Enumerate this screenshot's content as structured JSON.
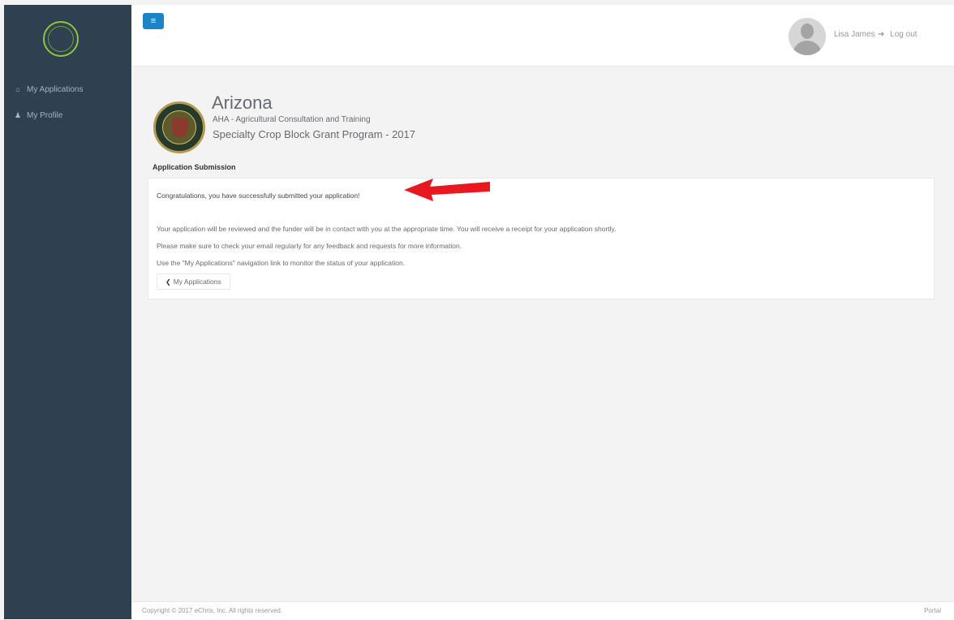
{
  "sidebar": {
    "items": [
      {
        "label": "My Applications",
        "icon": "home-icon",
        "glyph": "⌂"
      },
      {
        "label": "My Profile",
        "icon": "user-icon",
        "glyph": "♟"
      }
    ]
  },
  "topbar": {
    "menu_glyph": "≡",
    "user_name": "Lisa James",
    "logout_glyph": "➜",
    "logout_label": "Log out"
  },
  "header": {
    "org_name": "Arizona",
    "org_subtitle": "AHA - Agricultural Consultation and Training",
    "program_title": "Specialty Crop Block Grant Program - 2017"
  },
  "section": {
    "heading": "Application Submission"
  },
  "panel": {
    "congrats": "Congratulations, you have successfully submitted your application!",
    "line1": "Your application will be reviewed and the funder will be in contact with you at the appropriate time. You will receive a receipt for your application shortly.",
    "line2": "Please make sure to check your email regularly for any feedback and requests for more information.",
    "line3": "Use the \"My Applications\" navigation link to monitor the status of your application.",
    "back_button_glyph": "❮",
    "back_button_label": "My Applications"
  },
  "footer": {
    "copyright": "Copyright © 2017 eChris, Inc. All rights reserved.",
    "right_text": "Portal"
  },
  "colors": {
    "sidebar": "#2f4050",
    "accent": "#1c84c6",
    "arrow": "#e8191e",
    "logo": "#8dc63f"
  }
}
